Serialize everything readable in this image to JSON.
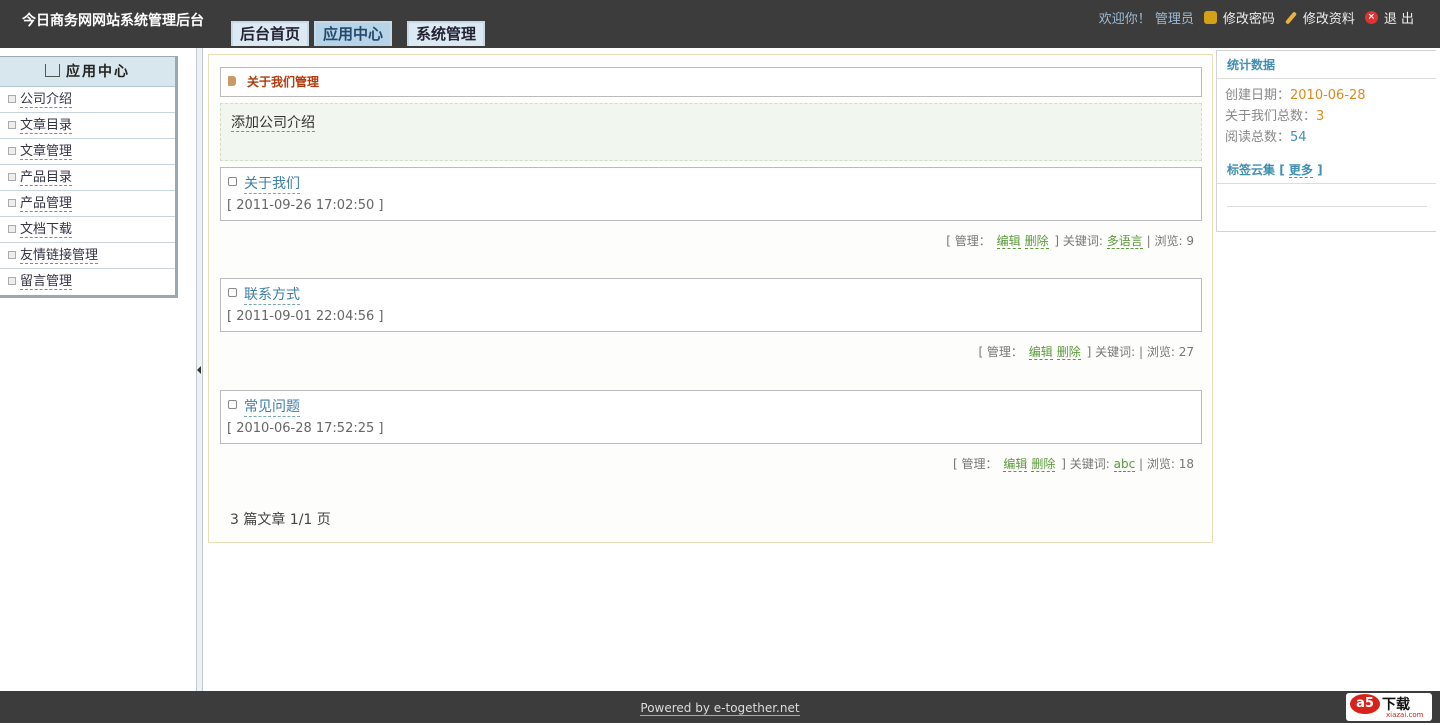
{
  "header": {
    "site_title": "今日商务网网站系统管理后台",
    "tabs": [
      {
        "label": "后台首页",
        "active": false
      },
      {
        "label": "应用中心",
        "active": true
      },
      {
        "label": "系统管理",
        "active": false
      }
    ],
    "welcome": "欢迎你！",
    "user": "管理员",
    "change_password": "修改密码",
    "edit_profile": "修改资料",
    "logout": "退 出",
    "icons": [
      "lock-icon",
      "pencil-icon",
      "close-icon"
    ]
  },
  "sidebar": {
    "title": "应用中心",
    "items": [
      {
        "label": "公司介绍"
      },
      {
        "label": "文章目录"
      },
      {
        "label": "文章管理"
      },
      {
        "label": "产品目录"
      },
      {
        "label": "产品管理"
      },
      {
        "label": "文档下载"
      },
      {
        "label": "友情链接管理"
      },
      {
        "label": "留言管理"
      }
    ]
  },
  "main": {
    "title": "关于我们管理",
    "add_link": "添加公司介绍",
    "articles": [
      {
        "title": "关于我们",
        "date": "[ 2011-09-26 17:02:50 ]",
        "manage_label": "[ 管理：",
        "edit": "编辑",
        "delete": "删除",
        "keyword_label": "] 关键词:",
        "keyword": "多语言",
        "views": "| 浏览: 9"
      },
      {
        "title": "联系方式",
        "date": "[ 2011-09-01 22:04:56 ]",
        "manage_label": "[ 管理：",
        "edit": "编辑",
        "delete": "删除",
        "keyword_label": "] 关键词:",
        "keyword": "",
        "views": "| 浏览: 27"
      },
      {
        "title": "常见问题",
        "date": "[ 2010-06-28 17:52:25 ]",
        "manage_label": "[ 管理：",
        "edit": "编辑",
        "delete": "删除",
        "keyword_label": "] 关键词:",
        "keyword": "abc",
        "views": "| 浏览: 18"
      }
    ],
    "pager": "3 篇文章  1/1 页"
  },
  "stats": {
    "title": "统计数据",
    "created_label": "创建日期：",
    "created_value": "2010-06-28",
    "about_count_label": "关于我们总数：",
    "about_count_value": "3",
    "read_count_label": "阅读总数：",
    "read_count_value": "54",
    "tags_title": "标签云集",
    "tags_more_open": "[",
    "tags_more": "更多",
    "tags_more_close": "]"
  },
  "footer": {
    "powered": "Powered by e-together.net",
    "watermark_logo": "a5",
    "watermark_text": "下载",
    "watermark_domain": "xiazai.com"
  }
}
